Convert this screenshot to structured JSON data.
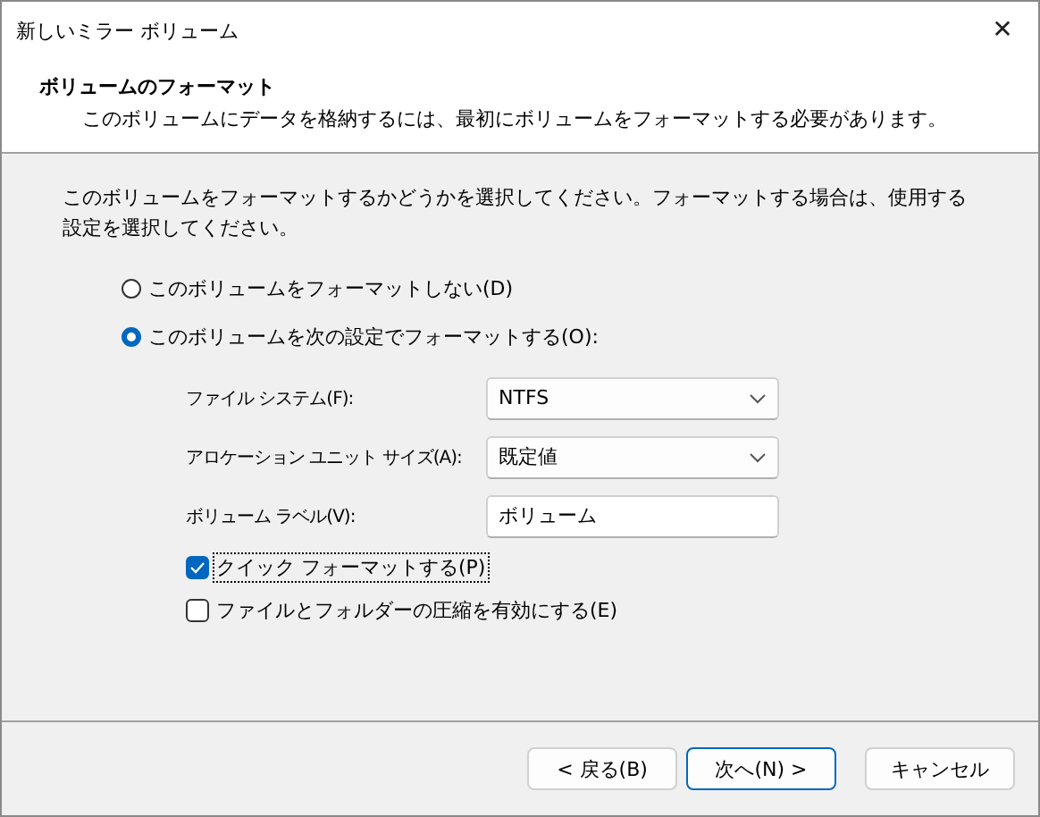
{
  "window": {
    "title": "新しいミラー ボリューム",
    "close": "✕"
  },
  "header": {
    "title": "ボリュームのフォーマット",
    "subtitle": "このボリュームにデータを格納するには、最初にボリュームをフォーマットする必要があります。"
  },
  "instruction": "このボリュームをフォーマットするかどうかを選択してください。フォーマットする場合は、使用する設定を選択してください。",
  "options": [
    {
      "label": "このボリュームをフォーマットしない(D)",
      "selected": false
    },
    {
      "label": "このボリュームを次の設定でフォーマットする(O):",
      "selected": true
    }
  ],
  "settings": [
    {
      "kind": "dropdown",
      "label": "ファイル システム(F):",
      "value": "NTFS"
    },
    {
      "kind": "dropdown",
      "label": "アロケーション ユニット サイズ(A):",
      "value": "既定値"
    },
    {
      "kind": "text",
      "label": "ボリューム ラベル(V):",
      "value": "ボリューム"
    }
  ],
  "checkboxes": [
    {
      "label": "クイック フォーマットする(P)",
      "checked": true,
      "focused": true
    },
    {
      "label": "ファイルとフォルダーの圧縮を有効にする(E)",
      "checked": false,
      "focused": false
    }
  ],
  "buttons": [
    {
      "label": "< 戻る(B)",
      "default": false
    },
    {
      "label": "次へ(N) >",
      "default": true
    },
    {
      "label": "キャンセル",
      "default": false
    }
  ]
}
